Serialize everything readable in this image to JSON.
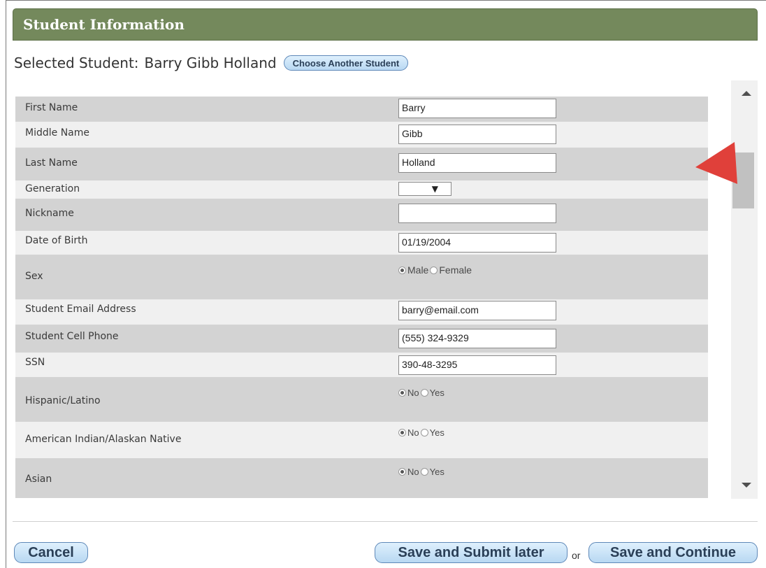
{
  "header": {
    "title": "Student Information"
  },
  "selected": {
    "label": "Selected Student:",
    "name": "Barry Gibb Holland",
    "choose_button": "Choose Another Student"
  },
  "fields": {
    "first_name": {
      "label": "First Name",
      "value": "Barry"
    },
    "middle_name": {
      "label": "Middle Name",
      "value": "Gibb"
    },
    "last_name": {
      "label": "Last Name",
      "value": "Holland"
    },
    "generation": {
      "label": "Generation",
      "value": "",
      "arrow": "▼"
    },
    "nickname": {
      "label": "Nickname",
      "value": ""
    },
    "dob": {
      "label": "Date of Birth",
      "value": "01/19/2004"
    },
    "sex": {
      "label": "Sex",
      "options": [
        "Male",
        "Female"
      ],
      "selected": "Male"
    },
    "email": {
      "label": "Student Email Address",
      "value": "barry@email.com"
    },
    "cell": {
      "label": "Student Cell Phone",
      "value": "(555) 324-9329"
    },
    "ssn": {
      "label": "SSN",
      "value": "390-48-3295"
    },
    "hispanic": {
      "label": "Hispanic/Latino",
      "options": [
        "No",
        "Yes"
      ],
      "selected": "No"
    },
    "american_indian": {
      "label": "American Indian/Alaskan Native",
      "options": [
        "No",
        "Yes"
      ],
      "selected": "No"
    },
    "asian": {
      "label": "Asian",
      "options": [
        "No",
        "Yes"
      ],
      "selected": "No"
    }
  },
  "buttons": {
    "cancel": "Cancel",
    "save_later": "Save and Submit later",
    "or": "or",
    "save_continue": "Save and Continue"
  },
  "colors": {
    "header_bg": "#74895c",
    "row_dark": "#d3d3d3",
    "row_light": "#f0f0f0",
    "button_border": "#5e88b8",
    "pointer_arrow": "#e0403a"
  },
  "icons": {
    "scroll_up": "scroll-up-arrow-icon",
    "scroll_down": "scroll-down-arrow-icon",
    "pointer": "red-pointer-arrow-icon"
  }
}
